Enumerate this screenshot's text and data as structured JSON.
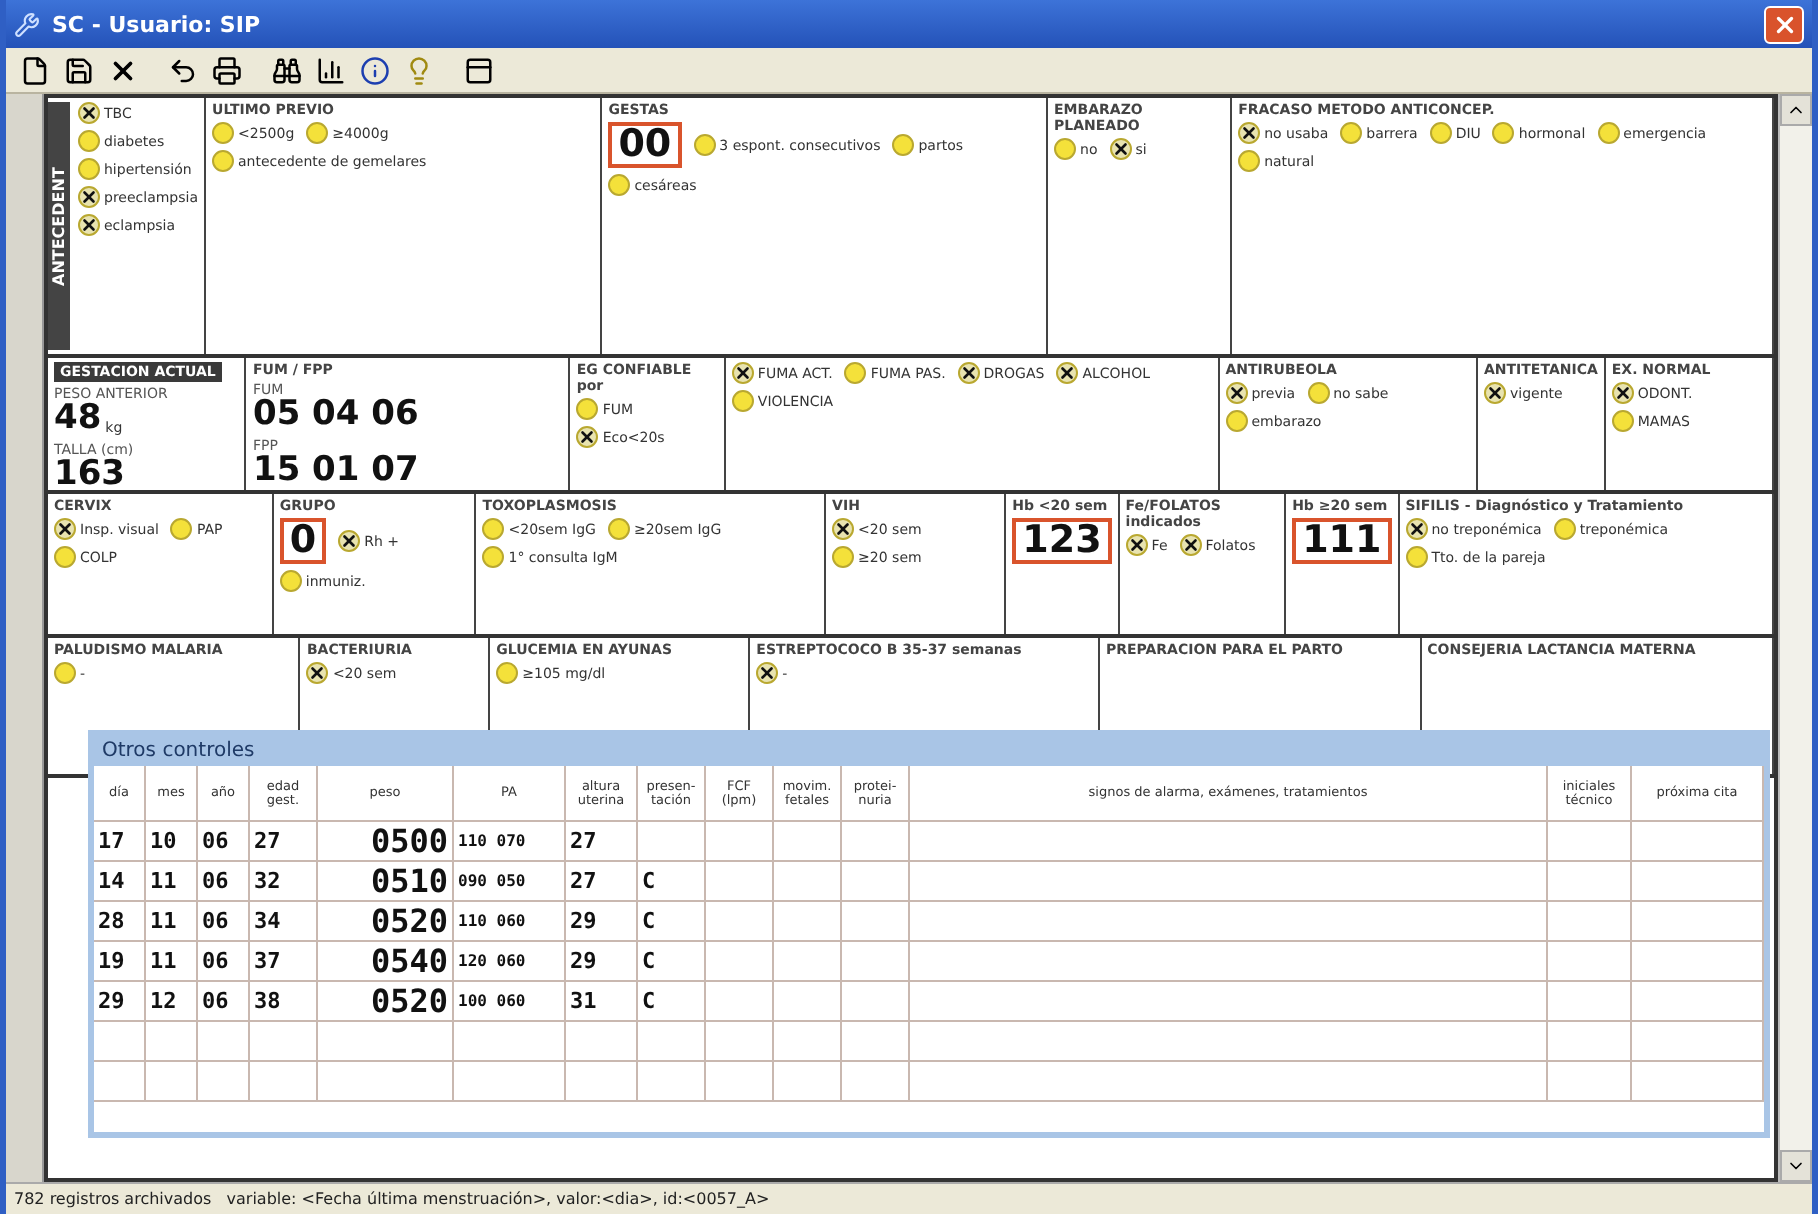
{
  "window": {
    "title": "SC - Usuario: SIP"
  },
  "form": {
    "rows": [
      {
        "sections": [
          {
            "title": "ANTECEDENT",
            "kind": "vertical",
            "items": [
              {
                "kind": "option",
                "label": "TBC",
                "checked": true
              },
              {
                "kind": "option",
                "label": "diabetes",
                "checked": false
              },
              {
                "kind": "option",
                "label": "hipertensión",
                "checked": false
              },
              {
                "kind": "option",
                "label": "preeclampsia",
                "checked": true
              },
              {
                "kind": "option",
                "label": "eclampsia",
                "checked": true
              }
            ]
          },
          {
            "title": "ULTIMO PREVIO",
            "items": [
              {
                "kind": "option",
                "label": "<2500g",
                "checked": false
              },
              {
                "kind": "option",
                "label": "≥4000g",
                "checked": false
              },
              {
                "kind": "option",
                "label": "antecedente de gemelares",
                "checked": false
              }
            ]
          },
          {
            "title": "GESTAS",
            "items": [
              {
                "kind": "number",
                "value": "00"
              },
              {
                "kind": "option",
                "label": "3 espont. consecutivos",
                "checked": false
              },
              {
                "kind": "option",
                "label": "partos",
                "checked": false
              },
              {
                "kind": "option",
                "label": "cesáreas",
                "checked": false
              }
            ]
          },
          {
            "title": "EMBARAZO PLANEADO",
            "items": [
              {
                "kind": "option",
                "label": "no",
                "checked": false
              },
              {
                "kind": "option",
                "label": "si",
                "checked": true
              }
            ]
          },
          {
            "title": "FRACASO METODO ANTICONCEP.",
            "items": [
              {
                "kind": "option",
                "label": "no usaba",
                "checked": true
              },
              {
                "kind": "option",
                "label": "barrera",
                "checked": false
              },
              {
                "kind": "option",
                "label": "DIU",
                "checked": false
              },
              {
                "kind": "option",
                "label": "hormonal",
                "checked": false
              },
              {
                "kind": "option",
                "label": "emergencia",
                "checked": false
              },
              {
                "kind": "option",
                "label": "natural",
                "checked": false
              }
            ]
          }
        ]
      },
      {
        "sections": [
          {
            "title": "GESTACION ACTUAL",
            "kind": "dark",
            "items": [
              {
                "kind": "number",
                "label": "PESO ANTERIOR",
                "value": "48",
                "unit": "kg"
              },
              {
                "kind": "number",
                "label": "TALLA (cm)",
                "value": "163"
              }
            ]
          },
          {
            "title": "FUM / FPP",
            "items": [
              {
                "kind": "number",
                "label": "FUM",
                "value": "05 04 06"
              },
              {
                "kind": "number",
                "label": "FPP",
                "value": "15 01 07"
              }
            ]
          },
          {
            "title": "EG CONFIABLE por",
            "items": [
              {
                "kind": "option",
                "label": "FUM",
                "checked": false
              },
              {
                "kind": "option",
                "label": "Eco<20s",
                "checked": true
              }
            ]
          },
          {
            "items": [
              {
                "kind": "option",
                "label": "FUMA ACT.",
                "checked": true
              },
              {
                "kind": "option",
                "label": "FUMA PAS.",
                "checked": false
              },
              {
                "kind": "option",
                "label": "DROGAS",
                "checked": true
              },
              {
                "kind": "option",
                "label": "ALCOHOL",
                "checked": true
              },
              {
                "kind": "option",
                "label": "VIOLENCIA",
                "checked": false
              }
            ]
          },
          {
            "title": "ANTIRUBEOLA",
            "items": [
              {
                "kind": "option",
                "label": "previa",
                "checked": true
              },
              {
                "kind": "option",
                "label": "no sabe",
                "checked": false
              },
              {
                "kind": "option",
                "label": "embarazo",
                "checked": false
              }
            ]
          },
          {
            "title": "ANTITETANICA",
            "items": [
              {
                "kind": "option",
                "label": "vigente",
                "checked": true
              }
            ]
          },
          {
            "title": "EX. NORMAL",
            "items": [
              {
                "kind": "option",
                "label": "ODONT.",
                "checked": true
              },
              {
                "kind": "option",
                "label": "MAMAS",
                "checked": false
              }
            ]
          }
        ]
      },
      {
        "sections": [
          {
            "title": "CERVIX",
            "items": [
              {
                "kind": "option",
                "label": "Insp. visual",
                "checked": true
              },
              {
                "kind": "option",
                "label": "PAP",
                "checked": false
              },
              {
                "kind": "option",
                "label": "COLP",
                "checked": false
              }
            ]
          },
          {
            "title": "GRUPO",
            "items": [
              {
                "kind": "number",
                "value": "0"
              },
              {
                "kind": "option",
                "label": "Rh +",
                "checked": true
              },
              {
                "kind": "option",
                "label": "inmuniz.",
                "checked": false
              }
            ]
          },
          {
            "title": "TOXOPLASMOSIS",
            "items": [
              {
                "kind": "option",
                "label": "<20sem IgG",
                "checked": false
              },
              {
                "kind": "option",
                "label": "≥20sem IgG",
                "checked": false
              },
              {
                "kind": "option",
                "label": "1° consulta IgM",
                "checked": false
              }
            ]
          },
          {
            "title": "VIH",
            "items": [
              {
                "kind": "option",
                "label": "<20 sem",
                "checked": true
              },
              {
                "kind": "option",
                "label": "≥20 sem",
                "checked": false
              }
            ]
          },
          {
            "title": "Hb <20 sem",
            "items": [
              {
                "kind": "number",
                "value": "123"
              }
            ]
          },
          {
            "title": "Fe/FOLATOS indicados",
            "items": [
              {
                "kind": "option",
                "label": "Fe",
                "checked": true
              },
              {
                "kind": "option",
                "label": "Folatos",
                "checked": true
              }
            ]
          },
          {
            "title": "Hb ≥20 sem",
            "items": [
              {
                "kind": "number",
                "value": "111"
              }
            ]
          },
          {
            "title": "SIFILIS - Diagnóstico y Tratamiento",
            "items": [
              {
                "kind": "option",
                "label": "no treponémica",
                "checked": true
              },
              {
                "kind": "option",
                "label": "treponémica",
                "checked": false
              },
              {
                "kind": "option",
                "label": "Tto. de la pareja",
                "checked": false
              }
            ]
          }
        ]
      },
      {
        "sections": [
          {
            "title": "PALUDISMO MALARIA",
            "items": [
              {
                "kind": "option",
                "label": "-",
                "checked": false
              }
            ]
          },
          {
            "title": "BACTERIURIA",
            "items": [
              {
                "kind": "option",
                "label": "<20 sem",
                "checked": true
              }
            ]
          },
          {
            "title": "GLUCEMIA EN AYUNAS",
            "items": [
              {
                "kind": "option",
                "label": "≥105 mg/dl",
                "checked": false
              }
            ]
          },
          {
            "title": "ESTREPTOCOCO B 35-37 semanas",
            "items": [
              {
                "kind": "option",
                "label": "-",
                "checked": true
              }
            ]
          },
          {
            "title": "PREPARACION PARA EL PARTO"
          },
          {
            "title": "CONSEJERIA LACTANCIA MATERNA"
          }
        ]
      }
    ]
  },
  "controls": {
    "title": "Otros controles",
    "columns": [
      "día",
      "mes",
      "año",
      "edad gest.",
      "peso",
      "PA",
      "altura uterina",
      "presen-tación",
      "FCF (lpm)",
      "movim. fetales",
      "protei-nuria",
      "signos de alarma, exámenes, tratamientos",
      "iniciales técnico",
      "próxima cita"
    ],
    "rows": [
      {
        "dia": "17",
        "mes": "10",
        "anio": "06",
        "edad": "27",
        "peso": "0500",
        "pa": "110 070",
        "altura": "27"
      },
      {
        "dia": "14",
        "mes": "11",
        "anio": "06",
        "edad": "32",
        "peso": "0510",
        "pa": "090 050",
        "altura": "27",
        "presentacion": "C"
      },
      {
        "dia": "28",
        "mes": "11",
        "anio": "06",
        "edad": "34",
        "peso": "0520",
        "pa": "110 060",
        "altura": "29",
        "presentacion": "C"
      },
      {
        "dia": "19",
        "mes": "11",
        "anio": "06",
        "edad": "37",
        "peso": "0540",
        "pa": "120 060",
        "altura": "29",
        "presentacion": "C"
      },
      {
        "dia": "29",
        "mes": "12",
        "anio": "06",
        "edad": "38",
        "peso": "0520",
        "pa": "100 060",
        "altura": "31",
        "presentacion": "C"
      }
    ]
  },
  "status_bar": "782 registros archivados   variable: <Fecha última menstruación>, valor:<dia>, id:<0057_A>"
}
